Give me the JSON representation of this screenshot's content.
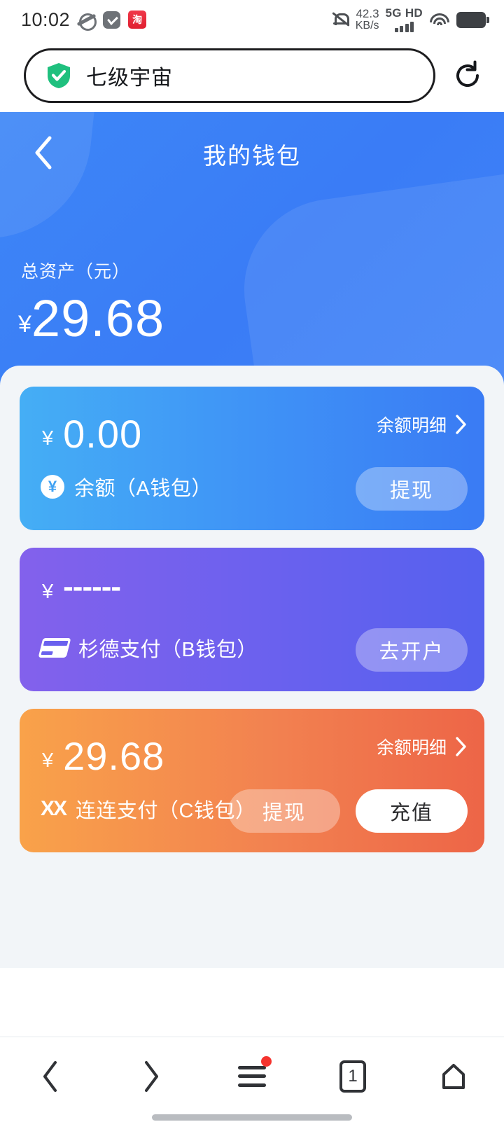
{
  "statusbar": {
    "time": "10:02",
    "icons_left": [
      "browser-planet-icon",
      "message-icon",
      "taobao-icon"
    ],
    "taobao_glyph": "淘",
    "mute_icon": "bell-muted-icon",
    "net_speed_value": "42.3",
    "net_speed_unit": "KB/s",
    "network_label": "5G HD",
    "wifi_icon": "wifi-icon",
    "battery_icon": "battery-full-icon"
  },
  "browser": {
    "url_text": "七级宇宙",
    "shield_icon": "verified-shield-icon",
    "shield_color": "#1fc07e",
    "reload_icon": "reload-icon",
    "nav": {
      "back_icon": "chevron-left-icon",
      "forward_icon": "chevron-right-icon",
      "menu_icon": "hamburger-menu-icon",
      "menu_badge": true,
      "tab_count": "1",
      "home_icon": "home-icon"
    }
  },
  "header": {
    "back_icon": "chevron-left-icon",
    "title": "我的钱包",
    "total_label": "总资产（元）",
    "currency_symbol": "¥",
    "total_amount": "29.68",
    "bg_color_start": "#3d86f7",
    "bg_color_end": "#3f82f8"
  },
  "detail_link_label": "余额明细",
  "cards": [
    {
      "id": "wallet-a",
      "currency_symbol": "¥",
      "amount": "0.00",
      "masked": false,
      "icon": "coin-yuan-icon",
      "name": "余额（A钱包）",
      "has_detail_link": true,
      "buttons": [
        {
          "label": "提现",
          "style": "ghost",
          "name": "withdraw-button"
        }
      ],
      "gradient_start": "#45aef5",
      "gradient_end": "#3a7bf4"
    },
    {
      "id": "wallet-b",
      "currency_symbol": "¥",
      "amount": "------",
      "masked": true,
      "icon": "sandpay-card-icon",
      "name": "杉德支付（B钱包）",
      "has_detail_link": false,
      "buttons": [
        {
          "label": "去开户",
          "style": "ghost",
          "name": "open-account-button"
        }
      ],
      "gradient_start": "#8361ec",
      "gradient_end": "#5561ee"
    },
    {
      "id": "wallet-c",
      "currency_symbol": "¥",
      "amount": "29.68",
      "masked": false,
      "icon": "lianlian-xx-icon",
      "icon_glyph": "XX",
      "name": "连连支付（C钱包）",
      "has_detail_link": true,
      "buttons": [
        {
          "label": "提现",
          "style": "ghost",
          "name": "withdraw-button"
        },
        {
          "label": "充值",
          "style": "solid",
          "name": "recharge-button"
        }
      ],
      "gradient_start": "#f9a24a",
      "gradient_end": "#ed6547"
    }
  ]
}
